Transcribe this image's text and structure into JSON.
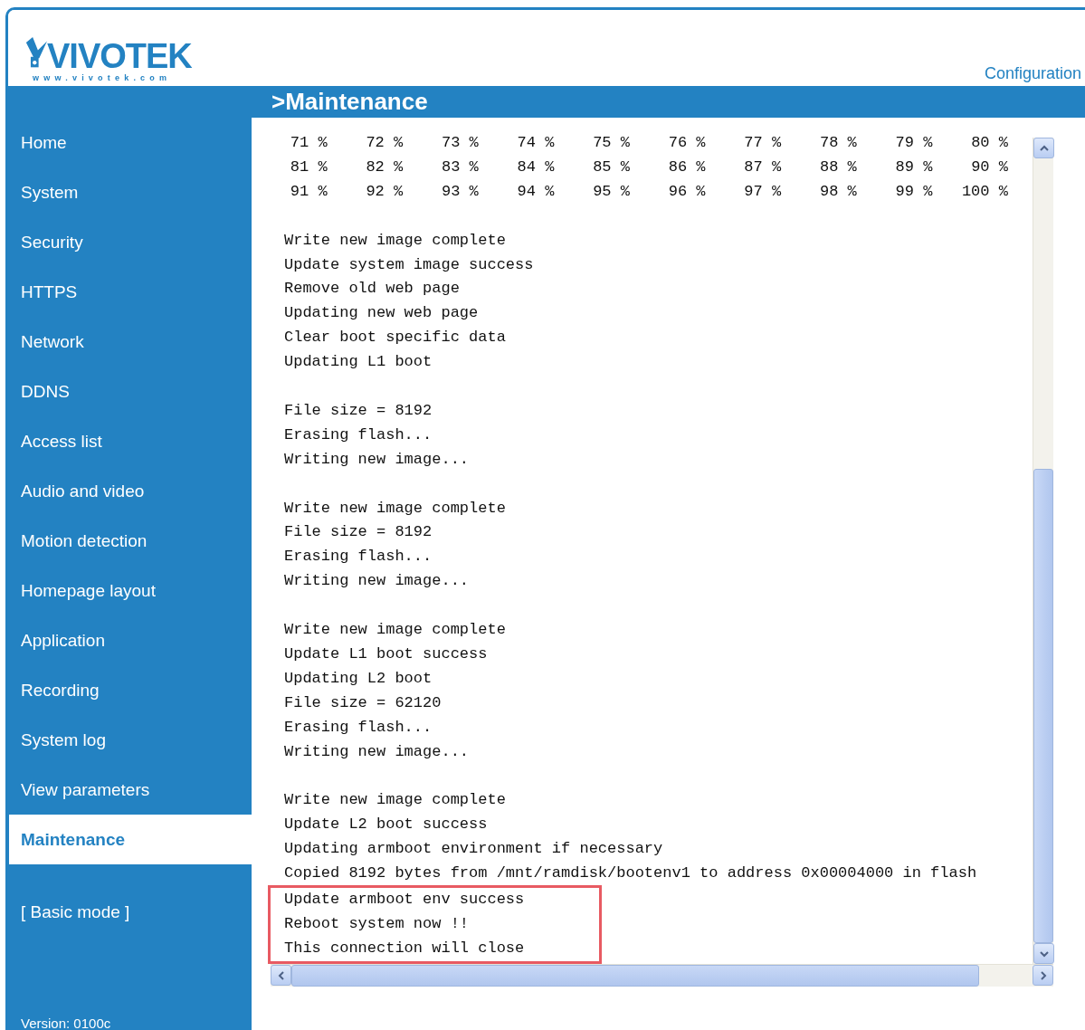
{
  "logo": {
    "name": "VIVOTEK",
    "url": "www.vivotek.com"
  },
  "header_link": "Configuration",
  "page_title": ">Maintenance",
  "sidebar": {
    "items": [
      {
        "label": "Home",
        "selected": false
      },
      {
        "label": "System",
        "selected": false
      },
      {
        "label": "Security",
        "selected": false
      },
      {
        "label": "HTTPS",
        "selected": false
      },
      {
        "label": "Network",
        "selected": false
      },
      {
        "label": "DDNS",
        "selected": false
      },
      {
        "label": "Access list",
        "selected": false
      },
      {
        "label": "Audio and video",
        "selected": false
      },
      {
        "label": "Motion detection",
        "selected": false
      },
      {
        "label": "Homepage layout",
        "selected": false
      },
      {
        "label": "Application",
        "selected": false
      },
      {
        "label": "Recording",
        "selected": false
      },
      {
        "label": "System log",
        "selected": false
      },
      {
        "label": "View parameters",
        "selected": false
      },
      {
        "label": "Maintenance",
        "selected": true
      }
    ],
    "mode_link": "[ Basic mode ]",
    "version": "Version: 0100c"
  },
  "log": {
    "progress_rows": [
      [
        "71 %",
        "72 %",
        "73 %",
        "74 %",
        "75 %",
        "76 %",
        "77 %",
        "78 %",
        "79 %",
        "80 %"
      ],
      [
        "81 %",
        "82 %",
        "83 %",
        "84 %",
        "85 %",
        "86 %",
        "87 %",
        "88 %",
        "89 %",
        "90 %"
      ],
      [
        "91 %",
        "92 %",
        "93 %",
        "94 %",
        "95 %",
        "96 %",
        "97 %",
        "98 %",
        "99 %",
        "100 %"
      ]
    ],
    "paragraphs": [
      {
        "lines": [
          {
            "text": "Write new image complete",
            "highlighted": false
          },
          {
            "text": "Update system image success",
            "highlighted": false
          },
          {
            "text": "Remove old web page",
            "highlighted": false
          },
          {
            "text": "Updating new web page",
            "highlighted": false
          },
          {
            "text": "Clear boot specific data",
            "highlighted": false
          },
          {
            "text": "Updating L1 boot",
            "highlighted": false
          }
        ]
      },
      {
        "lines": [
          {
            "text": "File size = 8192",
            "highlighted": false
          },
          {
            "text": "Erasing flash...",
            "highlighted": false
          },
          {
            "text": "Writing new image...",
            "highlighted": false
          }
        ]
      },
      {
        "lines": [
          {
            "text": "Write new image complete",
            "highlighted": false
          },
          {
            "text": "File size = 8192",
            "highlighted": false
          },
          {
            "text": "Erasing flash...",
            "highlighted": false
          },
          {
            "text": "Writing new image...",
            "highlighted": false
          }
        ]
      },
      {
        "lines": [
          {
            "text": "Write new image complete",
            "highlighted": false
          },
          {
            "text": "Update L1 boot success",
            "highlighted": false
          },
          {
            "text": "Updating L2 boot",
            "highlighted": false
          },
          {
            "text": "File size = 62120",
            "highlighted": false
          },
          {
            "text": "Erasing flash...",
            "highlighted": false
          },
          {
            "text": "Writing new image...",
            "highlighted": false
          }
        ]
      },
      {
        "lines": [
          {
            "text": "Write new image complete",
            "highlighted": false
          },
          {
            "text": "Update L2 boot success",
            "highlighted": false
          },
          {
            "text": "Updating armboot environment if necessary",
            "highlighted": false
          },
          {
            "text": "Copied 8192 bytes from /mnt/ramdisk/bootenv1 to address 0x00004000 in flash",
            "highlighted": false
          },
          {
            "text": "Update armboot env success",
            "highlighted": true
          },
          {
            "text": "Reboot system now !!",
            "highlighted": true
          },
          {
            "text": "This connection will close",
            "highlighted": true
          }
        ]
      }
    ]
  }
}
